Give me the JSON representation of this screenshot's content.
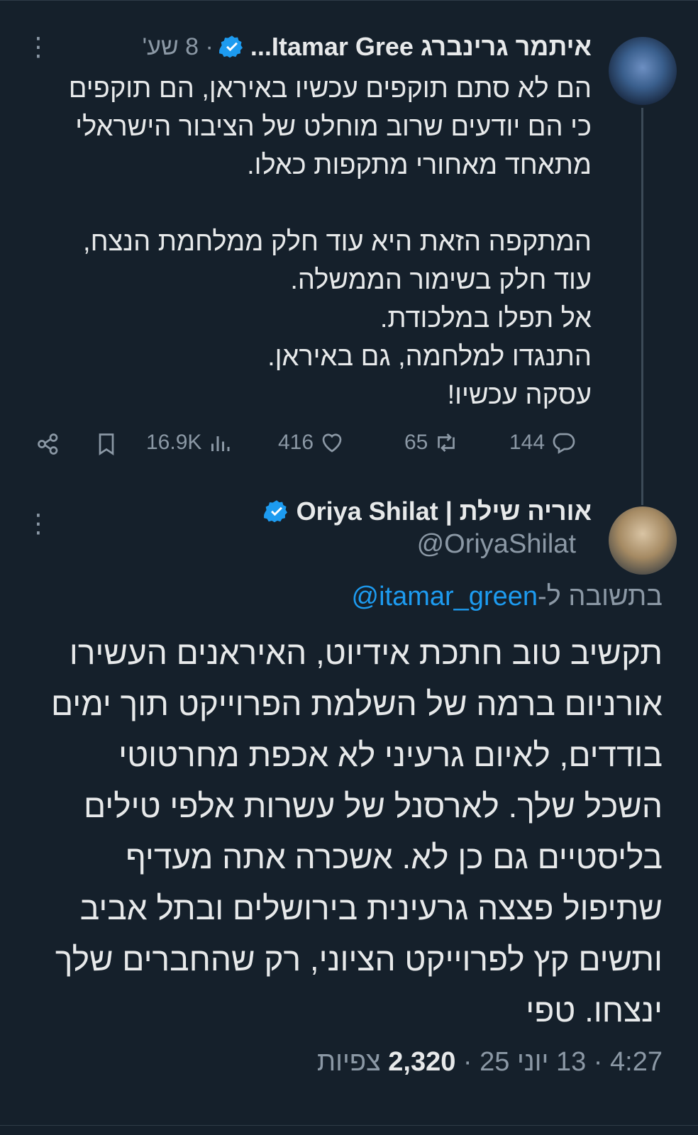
{
  "tweet1": {
    "author_name": "איתמר גרינברג Itamar Gree...",
    "time": "· 8 שע'",
    "lines_a": [
      "הם לא סתם תוקפים עכשיו באיראן, הם תוקפים",
      "כי הם יודעים שרוב מוחלט של הציבור הישראלי",
      "מתאחד מאחורי מתקפות כאלו."
    ],
    "lines_b": [
      "המתקפה הזאת היא עוד חלק ממלחמת הנצח,",
      "עוד חלק בשימור הממשלה.",
      "אל תפלו במלכודת.",
      "התנגדו למלחמה, גם באיראן.",
      "עסקה עכשיו!"
    ],
    "replies": "144",
    "retweets": "65",
    "likes": "416",
    "views": "16.9K"
  },
  "tweet2": {
    "author_name": "אוריה שילת | Oriya Shilat",
    "handle": "@OriyaShilat",
    "reply_prefix": "בתשובה ל-",
    "reply_mention": "@itamar_green",
    "lines": [
      "תקשיב טוב חתכת אידיוט, האיראנים העשירו",
      "אורניום ברמה של השלמת הפרוייקט תוך ימים",
      "בודדים, לאיום גרעיני לא אכפת מחרטוטי",
      "השכל שלך. לארסנל של עשרות אלפי טילים",
      "בליסטיים גם כן לא. אשכרה אתה מעדיף",
      "שתיפול פצצה גרעינית בירושלים ובתל אביב",
      "ותשים קץ לפרוייקט הציוני, רק שהחברים שלך",
      "ינצחו. טפי"
    ],
    "time": "4:27",
    "date": "13 יוני 25",
    "views_count": "2,320",
    "views_label": "צפיות"
  },
  "icons": {
    "more": "more-vertical-icon",
    "verified": "verified-badge-icon",
    "reply": "reply-icon",
    "retweet": "retweet-icon",
    "like": "heart-icon",
    "views": "views-bar-icon",
    "bookmark": "bookmark-icon",
    "share": "share-icon"
  },
  "colors": {
    "background": "#15202b",
    "text": "#e7e9ea",
    "muted": "#8b98a5",
    "accent": "#1d9bf0"
  }
}
